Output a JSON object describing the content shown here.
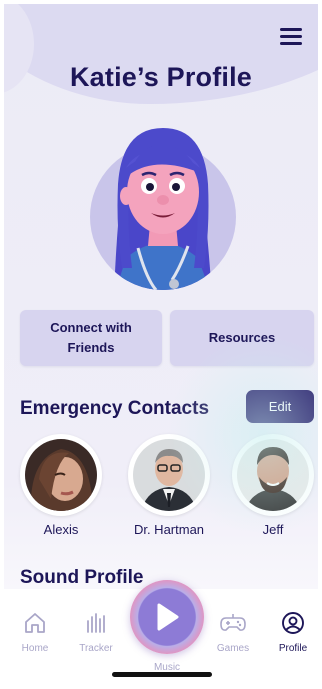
{
  "header": {
    "title": "Katie’s Profile"
  },
  "actions": {
    "connect_label": "Connect with Friends",
    "resources_label": "Resources"
  },
  "emergency": {
    "title": "Emergency Contacts",
    "edit_label": "Edit",
    "contacts": [
      {
        "name": "Alexis"
      },
      {
        "name": "Dr. Hartman"
      },
      {
        "name": "Jeff"
      }
    ]
  },
  "sound": {
    "title": "Sound Profile"
  },
  "nav": {
    "items": [
      {
        "label": "Home",
        "icon": "home-icon"
      },
      {
        "label": "Tracker",
        "icon": "tracker-bars-icon"
      },
      {
        "label": "Music",
        "icon": "play-icon"
      },
      {
        "label": "Games",
        "icon": "gamepad-icon"
      },
      {
        "label": "Profile",
        "icon": "user-circle-icon"
      }
    ],
    "active": "Profile"
  },
  "colors": {
    "primary": "#1d1658",
    "card": "#d7d4ef",
    "edit_button": "#261a69",
    "avatar_bg": "#c9c5ea"
  }
}
